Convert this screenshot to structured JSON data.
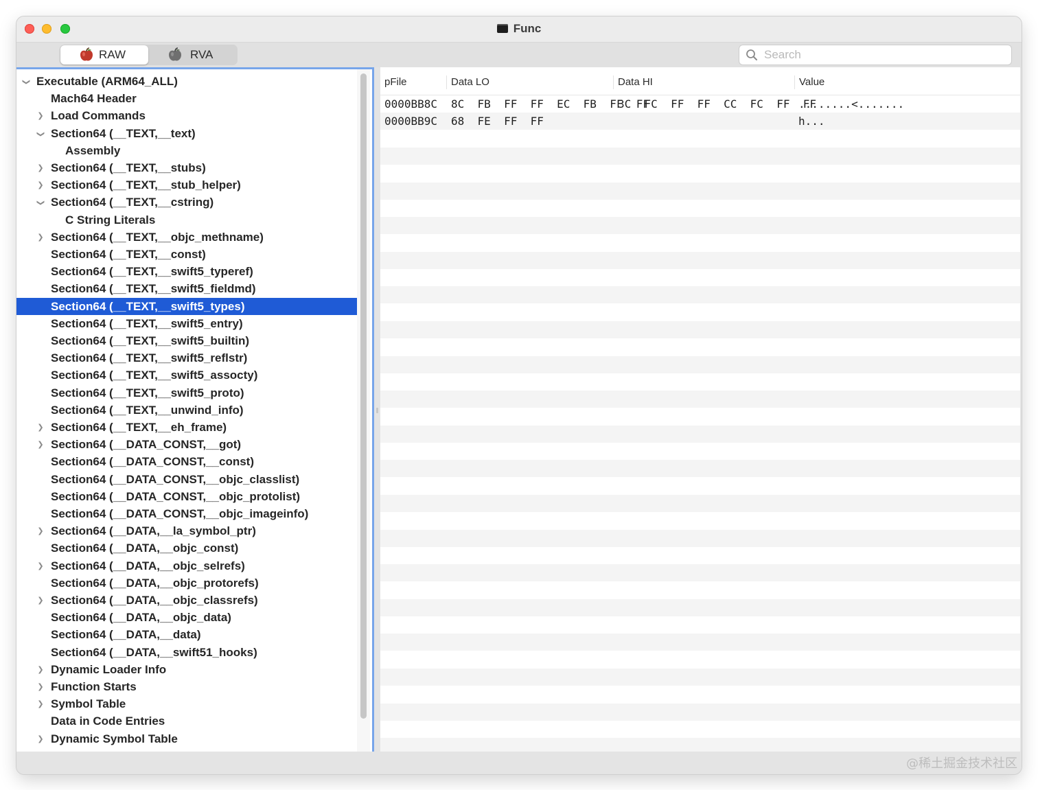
{
  "window": {
    "title": "Func",
    "toolbar": {
      "raw_label": "RAW",
      "rva_label": "RVA",
      "search_placeholder": "Search",
      "selected_mode": "RAW"
    }
  },
  "tree": {
    "items": [
      {
        "label": "Executable  (ARM64_ALL)",
        "level": 0,
        "chevron": "expanded"
      },
      {
        "label": "Mach64 Header",
        "level": 1,
        "chevron": "none"
      },
      {
        "label": "Load Commands",
        "level": 1,
        "chevron": "collapsed"
      },
      {
        "label": "Section64 (__TEXT,__text)",
        "level": 1,
        "chevron": "expanded"
      },
      {
        "label": "Assembly",
        "level": 2,
        "chevron": "none"
      },
      {
        "label": "Section64 (__TEXT,__stubs)",
        "level": 1,
        "chevron": "collapsed"
      },
      {
        "label": "Section64 (__TEXT,__stub_helper)",
        "level": 1,
        "chevron": "collapsed"
      },
      {
        "label": "Section64 (__TEXT,__cstring)",
        "level": 1,
        "chevron": "expanded"
      },
      {
        "label": "C String Literals",
        "level": 2,
        "chevron": "none"
      },
      {
        "label": "Section64 (__TEXT,__objc_methname)",
        "level": 1,
        "chevron": "collapsed"
      },
      {
        "label": "Section64 (__TEXT,__const)",
        "level": 1,
        "chevron": "none"
      },
      {
        "label": "Section64 (__TEXT,__swift5_typeref)",
        "level": 1,
        "chevron": "none"
      },
      {
        "label": "Section64 (__TEXT,__swift5_fieldmd)",
        "level": 1,
        "chevron": "none"
      },
      {
        "label": "Section64 (__TEXT,__swift5_types)",
        "level": 1,
        "chevron": "none",
        "selected": true
      },
      {
        "label": "Section64 (__TEXT,__swift5_entry)",
        "level": 1,
        "chevron": "none"
      },
      {
        "label": "Section64 (__TEXT,__swift5_builtin)",
        "level": 1,
        "chevron": "none"
      },
      {
        "label": "Section64 (__TEXT,__swift5_reflstr)",
        "level": 1,
        "chevron": "none"
      },
      {
        "label": "Section64 (__TEXT,__swift5_assocty)",
        "level": 1,
        "chevron": "none"
      },
      {
        "label": "Section64 (__TEXT,__swift5_proto)",
        "level": 1,
        "chevron": "none"
      },
      {
        "label": "Section64 (__TEXT,__unwind_info)",
        "level": 1,
        "chevron": "none"
      },
      {
        "label": "Section64 (__TEXT,__eh_frame)",
        "level": 1,
        "chevron": "collapsed"
      },
      {
        "label": "Section64 (__DATA_CONST,__got)",
        "level": 1,
        "chevron": "collapsed"
      },
      {
        "label": "Section64 (__DATA_CONST,__const)",
        "level": 1,
        "chevron": "none"
      },
      {
        "label": "Section64 (__DATA_CONST,__objc_classlist)",
        "level": 1,
        "chevron": "none"
      },
      {
        "label": "Section64 (__DATA_CONST,__objc_protolist)",
        "level": 1,
        "chevron": "none"
      },
      {
        "label": "Section64 (__DATA_CONST,__objc_imageinfo)",
        "level": 1,
        "chevron": "none"
      },
      {
        "label": "Section64 (__DATA,__la_symbol_ptr)",
        "level": 1,
        "chevron": "collapsed"
      },
      {
        "label": "Section64 (__DATA,__objc_const)",
        "level": 1,
        "chevron": "none"
      },
      {
        "label": "Section64 (__DATA,__objc_selrefs)",
        "level": 1,
        "chevron": "collapsed"
      },
      {
        "label": "Section64 (__DATA,__objc_protorefs)",
        "level": 1,
        "chevron": "none"
      },
      {
        "label": "Section64 (__DATA,__objc_classrefs)",
        "level": 1,
        "chevron": "collapsed"
      },
      {
        "label": "Section64 (__DATA,__objc_data)",
        "level": 1,
        "chevron": "none"
      },
      {
        "label": "Section64 (__DATA,__data)",
        "level": 1,
        "chevron": "none"
      },
      {
        "label": "Section64 (__DATA,__swift51_hooks)",
        "level": 1,
        "chevron": "none"
      },
      {
        "label": "Dynamic Loader Info",
        "level": 1,
        "chevron": "collapsed"
      },
      {
        "label": "Function Starts",
        "level": 1,
        "chevron": "collapsed"
      },
      {
        "label": "Symbol Table",
        "level": 1,
        "chevron": "collapsed"
      },
      {
        "label": "Data in Code Entries",
        "level": 1,
        "chevron": "none"
      },
      {
        "label": "Dynamic Symbol Table",
        "level": 1,
        "chevron": "collapsed"
      }
    ]
  },
  "table": {
    "columns": [
      "pFile",
      "Data LO",
      "Data HI",
      "Value"
    ],
    "rows": [
      {
        "pFile": "0000BB8C",
        "data_lo": "8C  FB  FF  FF  EC  FB  FF  FF",
        "data_hi": "3C  FC  FF  FF  CC  FC  FF  FF",
        "value": "........<......."
      },
      {
        "pFile": "0000BB9C",
        "data_lo": "68  FE  FF  FF",
        "data_hi": "",
        "value": "h..."
      }
    ]
  },
  "watermark": "@稀土掘金技术社区",
  "colors": {
    "selection": "#1f5bd6",
    "focus_ring": "#77a5ea",
    "close": "#fe5f57",
    "minimize": "#febc2e",
    "zoom": "#28c840"
  },
  "icons": {
    "raw_icon": "apple-icon",
    "rva_icon": "apple-icon",
    "search_icon": "magnifier-icon",
    "title_icon": "terminal-document-icon"
  }
}
